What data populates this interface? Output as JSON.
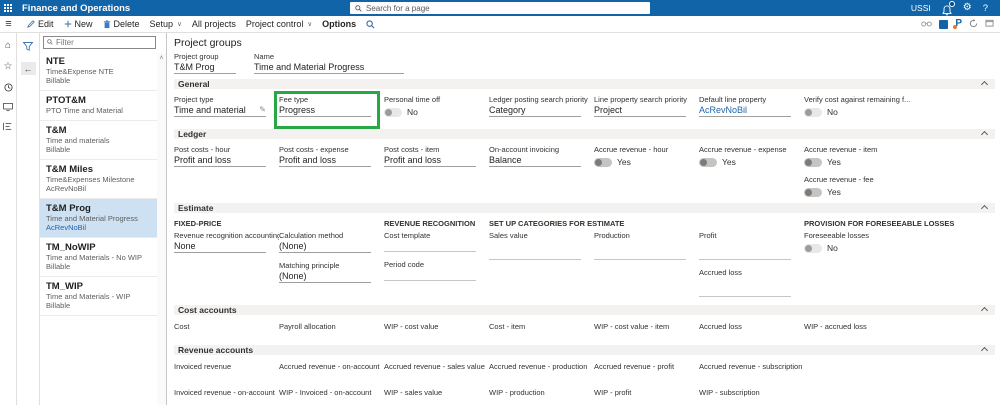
{
  "icons": {
    "hamburger": "≡",
    "home": "⌂",
    "star": "☆",
    "back_arrow": "←",
    "chevron_down": "∨",
    "chevron_up": "∧",
    "gear": "⚙",
    "help": "?",
    "pencil": "✎",
    "power_apps_letter": "P"
  },
  "app_bar": {
    "title": "Finance and Operations",
    "search_placeholder": "Search for a page",
    "company": "USSI"
  },
  "action_bar": {
    "edit": "Edit",
    "new": "New",
    "delete": "Delete",
    "setup": "Setup",
    "all_projects": "All projects",
    "project_control": "Project control",
    "options": "Options"
  },
  "list_panel": {
    "filter_placeholder": "Filter",
    "items": [
      {
        "name": "NTE",
        "line1": "Time&Expense NTE",
        "line2": "Billable"
      },
      {
        "name": "PTOT&M",
        "line1": "PTO Time and Material",
        "line2": ""
      },
      {
        "name": "T&M",
        "line1": "Time and materials",
        "line2": "Billable"
      },
      {
        "name": "T&M Miles",
        "line1": "Time&Expenses Milestone",
        "line2": "AcRevNoBil"
      },
      {
        "name": "T&M Prog",
        "line1": "Time and Material Progress",
        "line2": "AcRevNoBil"
      },
      {
        "name": "TM_NoWIP",
        "line1": "Time and Materials - No WIP",
        "line2": "Billable"
      },
      {
        "name": "TM_WIP",
        "line1": "Time and Materials - WIP",
        "line2": "Billable"
      }
    ]
  },
  "page": {
    "title": "Project groups",
    "header_fields": {
      "project_group_label": "Project group",
      "project_group_value": "T&M Prog",
      "name_label": "Name",
      "name_value": "Time and Material Progress"
    },
    "sections": {
      "general": {
        "title": "General",
        "project_type": {
          "label": "Project type",
          "value": "Time and material"
        },
        "fee_type": {
          "label": "Fee type",
          "value": "Progress"
        },
        "personal_time_off": {
          "label": "Personal time off",
          "value": "No"
        },
        "ledger_posting": {
          "label": "Ledger posting search priority",
          "value": "Category"
        },
        "line_property": {
          "label": "Line property search priority",
          "value": "Project"
        },
        "default_line_property": {
          "label": "Default line property",
          "value": "AcRevNoBil"
        },
        "verify_cost": {
          "label": "Verify cost against remaining f...",
          "value": "No"
        }
      },
      "ledger": {
        "title": "Ledger",
        "post_costs_hour": {
          "label": "Post costs - hour",
          "value": "Profit and loss"
        },
        "post_costs_expense": {
          "label": "Post costs - expense",
          "value": "Profit and loss"
        },
        "post_costs_item": {
          "label": "Post costs - item",
          "value": "Profit and loss"
        },
        "on_account_invoicing": {
          "label": "On-account invoicing",
          "value": "Balance"
        },
        "accrue_hour": {
          "label": "Accrue revenue - hour",
          "value": "Yes"
        },
        "accrue_expense": {
          "label": "Accrue revenue - expense",
          "value": "Yes"
        },
        "accrue_item": {
          "label": "Accrue revenue - item",
          "value": "Yes"
        },
        "accrue_fee": {
          "label": "Accrue revenue - fee",
          "value": "Yes"
        }
      },
      "estimate": {
        "title": "Estimate",
        "fixed_price_header": "FIXED-PRICE",
        "rev_rec_accounting": {
          "label": "Revenue recognition accounting...",
          "value": "None"
        },
        "calculation_method": {
          "label": "Calculation method",
          "value": "(None)"
        },
        "matching_principle": {
          "label": "Matching principle",
          "value": "(None)"
        },
        "revenue_recognition_header": "REVENUE RECOGNITION",
        "cost_template": {
          "label": "Cost template",
          "value": ""
        },
        "period_code": {
          "label": "Period code",
          "value": ""
        },
        "setup_categories_header": "SET UP CATEGORIES FOR ESTIMATE",
        "sales_value": {
          "label": "Sales value",
          "value": ""
        },
        "production": {
          "label": "Production",
          "value": ""
        },
        "profit": {
          "label": "Profit",
          "value": ""
        },
        "accrued_loss": {
          "label": "Accrued loss",
          "value": ""
        },
        "provision_header": "PROVISION FOR FORESEEABLE LOSSES",
        "foreseeable_losses": {
          "label": "Foreseeable losses",
          "value": "No"
        }
      },
      "cost_accounts": {
        "title": "Cost accounts",
        "fields": [
          "Cost",
          "Payroll allocation",
          "WIP - cost value",
          "Cost - item",
          "WIP - cost value - item",
          "Accrued loss",
          "WIP - accrued loss"
        ]
      },
      "revenue_accounts": {
        "title": "Revenue accounts",
        "row1": [
          "Invoiced revenue",
          "Accrued revenue - on-account",
          "Accrued revenue - sales value",
          "Accrued revenue - production",
          "Accrued revenue - profit",
          "Accrued revenue - subscription"
        ],
        "row2": [
          "Invoiced revenue - on-account",
          "WIP - Invoiced - on-account",
          "WIP - sales value",
          "WIP - production",
          "WIP - profit",
          "WIP - subscription"
        ]
      }
    }
  },
  "colors": {
    "app_bar_blue": "#1164a8",
    "selected_item_blue": "#cde1f3",
    "link_blue": "#1f63ad",
    "annotation_green": "#28a745",
    "section_strip_gray": "#f3f2f1"
  }
}
